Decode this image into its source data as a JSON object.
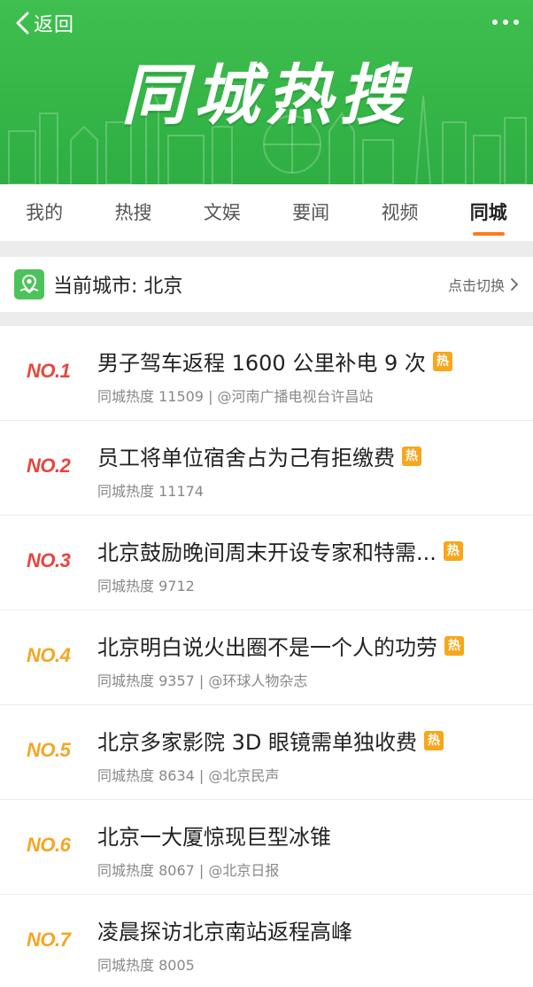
{
  "header": {
    "back_label": "返回",
    "title": "同城热搜"
  },
  "tabs": [
    {
      "label": "我的"
    },
    {
      "label": "热搜"
    },
    {
      "label": "文娱"
    },
    {
      "label": "要闻"
    },
    {
      "label": "视频"
    },
    {
      "label": "同城",
      "active": true
    }
  ],
  "city": {
    "label": "当前城市: 北京",
    "switch_label": "点击切换"
  },
  "items": [
    {
      "rank": "NO.1",
      "title": "男子驾车返程 1600 公里补电 9 次",
      "hot": "热",
      "meta": "同城热度 11509 | @河南广播电视台许昌站"
    },
    {
      "rank": "NO.2",
      "title": "员工将单位宿舍占为己有拒缴费",
      "hot": "热",
      "meta": "同城热度 11174"
    },
    {
      "rank": "NO.3",
      "title": "北京鼓励晚间周末开设专家和特需...",
      "hot": "热",
      "meta": "同城热度 9712"
    },
    {
      "rank": "NO.4",
      "title": "北京明白说火出圈不是一个人的功劳",
      "hot": "热",
      "meta": "同城热度 9357 | @环球人物杂志"
    },
    {
      "rank": "NO.5",
      "title": "北京多家影院 3D 眼镜需单独收费",
      "hot": "热",
      "meta": "同城热度 8634 | @北京民声"
    },
    {
      "rank": "NO.6",
      "title": "北京一大厦惊现巨型冰锥",
      "hot": "",
      "meta": "同城热度 8067 | @北京日报"
    },
    {
      "rank": "NO.7",
      "title": "凌晨探访北京南站返程高峰",
      "hot": "",
      "meta": "同城热度 8005"
    }
  ],
  "colors": {
    "brand_green": "#36b848",
    "accent_orange": "#ff7a1a",
    "rank_top": "#e8453c",
    "rank_rest": "#f5a623",
    "hot_badge": "#f8a61a"
  },
  "icons": {
    "back": "chevron-left-icon",
    "more": "more-dots-icon",
    "city": "location-map-icon",
    "switch": "chevron-right-icon"
  }
}
